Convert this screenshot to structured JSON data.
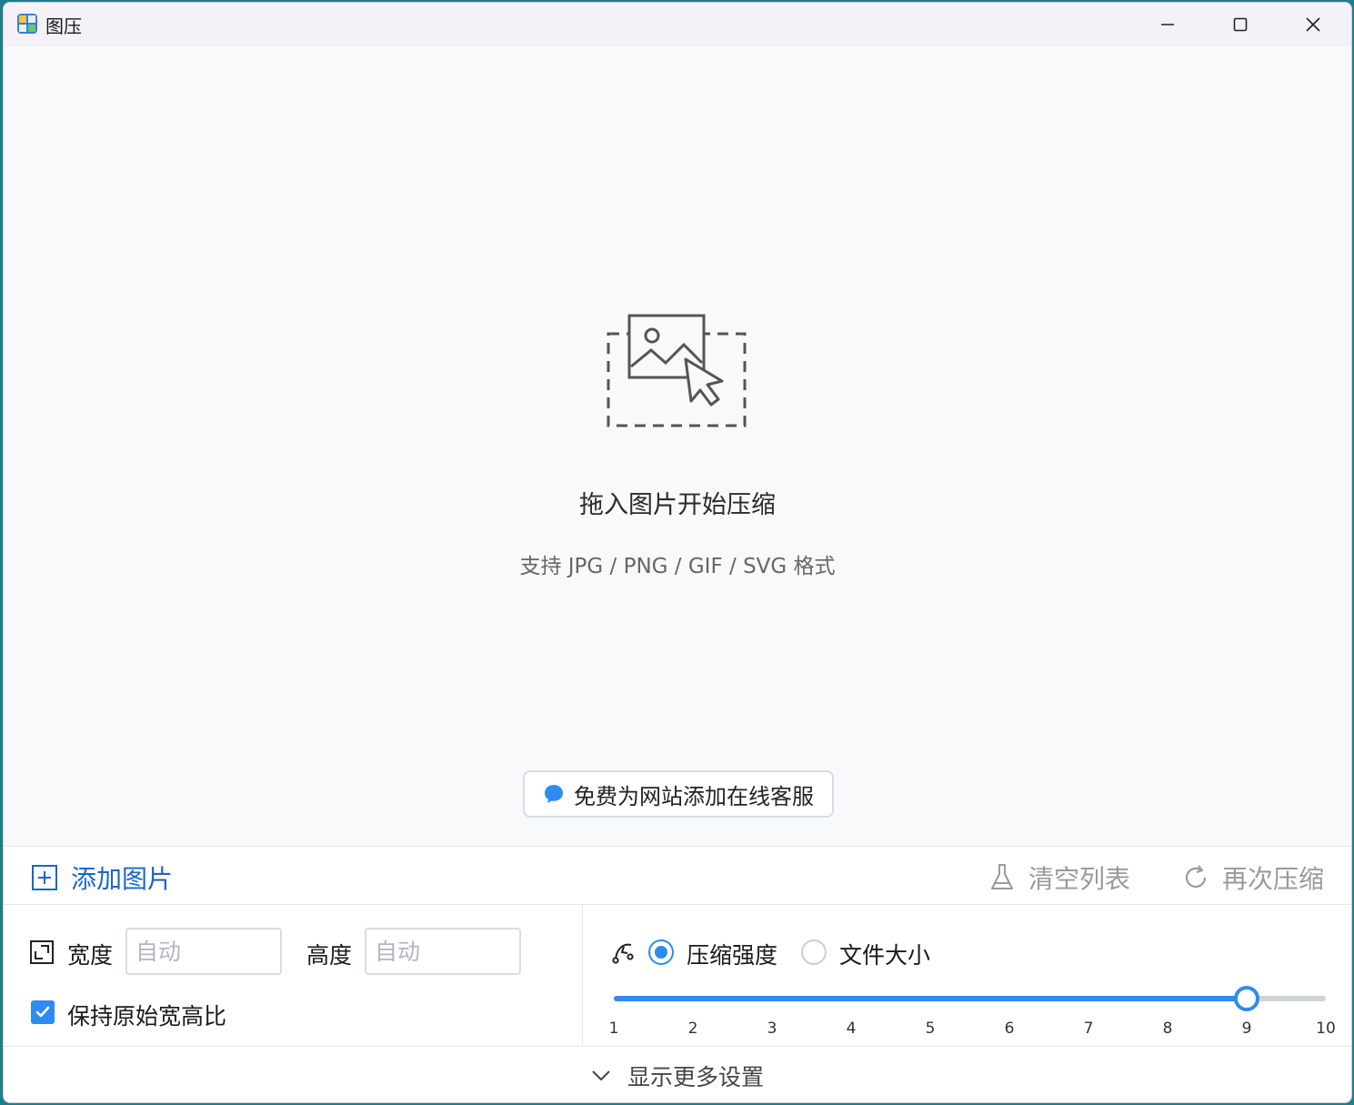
{
  "window": {
    "title": "图压"
  },
  "dropzone": {
    "title": "拖入图片开始压缩",
    "subtitle": "支持 JPG / PNG / GIF / SVG 格式",
    "service_button": "免费为网站添加在线客服"
  },
  "toolbar": {
    "add_label": "添加图片",
    "clear_label": "清空列表",
    "recompress_label": "再次压缩"
  },
  "settings": {
    "width_label": "宽度",
    "width_placeholder": "自动",
    "height_label": "高度",
    "height_placeholder": "自动",
    "keep_ratio_label": "保持原始宽高比",
    "keep_ratio_checked": true,
    "mode_strength_label": "压缩强度",
    "mode_size_label": "文件大小",
    "selected_mode": "strength",
    "slider": {
      "min": 1,
      "max": 10,
      "value": 9,
      "ticks": [
        "1",
        "2",
        "3",
        "4",
        "5",
        "6",
        "7",
        "8",
        "9",
        "10"
      ]
    }
  },
  "more_settings_label": "显示更多设置",
  "colors": {
    "accent": "#2e8cf0",
    "link": "#1a66c9",
    "disabled": "#9a9a9a"
  }
}
